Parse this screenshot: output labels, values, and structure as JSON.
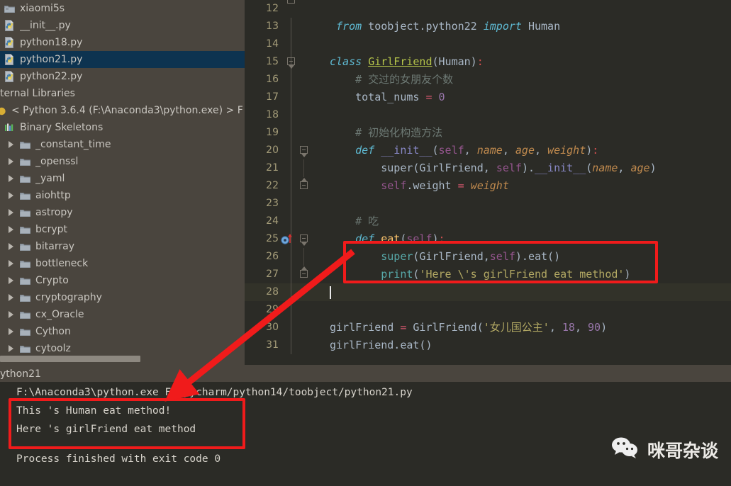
{
  "sidebar": {
    "top_partial_row": "",
    "items": [
      {
        "label": "xiaomi5s",
        "icon": "folder-icon",
        "type": "folder-plain",
        "selected": false
      },
      {
        "label": "__init__.py",
        "icon": "python-file-icon",
        "type": "pyfile",
        "selected": false
      },
      {
        "label": "python18.py",
        "icon": "python-file-icon",
        "type": "pyfile",
        "selected": false
      },
      {
        "label": "python21.py",
        "icon": "python-file-icon",
        "type": "pyfile",
        "selected": true
      },
      {
        "label": "python22.py",
        "icon": "python-file-icon",
        "type": "pyfile",
        "selected": false
      },
      {
        "label": "ternal Libraries",
        "icon": "none",
        "type": "text",
        "selected": false
      },
      {
        "label": "< Python 3.6.4 (F:\\Anaconda3\\python.exe) >  F",
        "icon": "sdk-icon",
        "type": "sdk",
        "selected": false
      },
      {
        "label": "Binary Skeletons",
        "icon": "skeleton-icon",
        "type": "skeleton",
        "selected": false
      },
      {
        "label": "_constant_time",
        "icon": "folder-icon",
        "type": "folder",
        "selected": false
      },
      {
        "label": "_openssl",
        "icon": "folder-icon",
        "type": "folder",
        "selected": false
      },
      {
        "label": "_yaml",
        "icon": "folder-icon",
        "type": "folder",
        "selected": false
      },
      {
        "label": "aiohttp",
        "icon": "folder-icon",
        "type": "folder",
        "selected": false
      },
      {
        "label": "astropy",
        "icon": "folder-icon",
        "type": "folder",
        "selected": false
      },
      {
        "label": "bcrypt",
        "icon": "folder-icon",
        "type": "folder",
        "selected": false
      },
      {
        "label": "bitarray",
        "icon": "folder-icon",
        "type": "folder",
        "selected": false
      },
      {
        "label": "bottleneck",
        "icon": "folder-icon",
        "type": "folder",
        "selected": false
      },
      {
        "label": "Crypto",
        "icon": "folder-icon",
        "type": "folder",
        "selected": false
      },
      {
        "label": "cryptography",
        "icon": "folder-icon",
        "type": "folder",
        "selected": false
      },
      {
        "label": "cx_Oracle",
        "icon": "folder-icon",
        "type": "folder",
        "selected": false
      },
      {
        "label": "Cython",
        "icon": "folder-icon",
        "type": "folder",
        "selected": false
      },
      {
        "label": "cytoolz",
        "icon": "folder-icon",
        "type": "folder",
        "selected": false
      }
    ]
  },
  "editor": {
    "lines": [
      {
        "n": "12",
        "tokens": [],
        "fold": "end-top",
        "current": false
      },
      {
        "n": "13",
        "tokens": [
          {
            "t": " ",
            "c": "plain"
          },
          {
            "t": "from",
            "c": "kw2"
          },
          {
            "t": " toobject.python22 ",
            "c": "plain"
          },
          {
            "t": "import",
            "c": "kw2"
          },
          {
            "t": " Human",
            "c": "plain"
          }
        ],
        "fold": "line",
        "current": false
      },
      {
        "n": "14",
        "tokens": [],
        "fold": "line",
        "current": false
      },
      {
        "n": "15",
        "tokens": [
          {
            "t": "class",
            "c": "kw2"
          },
          {
            "t": " ",
            "c": "plain"
          },
          {
            "t": "GirlFriend",
            "c": "cls"
          },
          {
            "t": "(Human)",
            "c": "plain"
          },
          {
            "t": ":",
            "c": "punct"
          }
        ],
        "fold": "open",
        "current": false
      },
      {
        "n": "16",
        "tokens": [
          {
            "t": "    # 交过的女朋友个数",
            "c": "cmt"
          }
        ],
        "fold": "bar",
        "current": false
      },
      {
        "n": "17",
        "tokens": [
          {
            "t": "    total_nums ",
            "c": "plain"
          },
          {
            "t": "=",
            "c": "op"
          },
          {
            "t": " ",
            "c": "plain"
          },
          {
            "t": "0",
            "c": "num"
          }
        ],
        "fold": "bar",
        "current": false
      },
      {
        "n": "18",
        "tokens": [],
        "fold": "bar",
        "current": false
      },
      {
        "n": "19",
        "tokens": [
          {
            "t": "    # 初始化构造方法",
            "c": "cmt"
          }
        ],
        "fold": "bar",
        "current": false
      },
      {
        "n": "20",
        "tokens": [
          {
            "t": "    ",
            "c": "plain"
          },
          {
            "t": "def",
            "c": "kw2"
          },
          {
            "t": " ",
            "c": "plain"
          },
          {
            "t": "__init__",
            "c": "builtin"
          },
          {
            "t": "(",
            "c": "plain"
          },
          {
            "t": "self",
            "c": "self"
          },
          {
            "t": ", ",
            "c": "plain"
          },
          {
            "t": "name",
            "c": "param"
          },
          {
            "t": ", ",
            "c": "plain"
          },
          {
            "t": "age",
            "c": "param"
          },
          {
            "t": ", ",
            "c": "plain"
          },
          {
            "t": "weight",
            "c": "param"
          },
          {
            "t": ")",
            "c": "plain"
          },
          {
            "t": ":",
            "c": "punct"
          }
        ],
        "fold": "open-inner",
        "current": false
      },
      {
        "n": "21",
        "tokens": [
          {
            "t": "        super(GirlFriend, ",
            "c": "plain"
          },
          {
            "t": "self",
            "c": "self"
          },
          {
            "t": ").",
            "c": "plain"
          },
          {
            "t": "__init__",
            "c": "builtin"
          },
          {
            "t": "(",
            "c": "plain"
          },
          {
            "t": "name",
            "c": "param"
          },
          {
            "t": ", ",
            "c": "plain"
          },
          {
            "t": "age",
            "c": "param"
          },
          {
            "t": ")",
            "c": "plain"
          }
        ],
        "fold": "bar2",
        "current": false
      },
      {
        "n": "22",
        "tokens": [
          {
            "t": "        ",
            "c": "plain"
          },
          {
            "t": "self",
            "c": "self"
          },
          {
            "t": ".weight ",
            "c": "plain"
          },
          {
            "t": "=",
            "c": "op"
          },
          {
            "t": " ",
            "c": "plain"
          },
          {
            "t": "weight",
            "c": "param"
          }
        ],
        "fold": "close-inner",
        "current": false
      },
      {
        "n": "23",
        "tokens": [],
        "fold": "bar",
        "current": false
      },
      {
        "n": "24",
        "tokens": [
          {
            "t": "    # 吃",
            "c": "cmt"
          }
        ],
        "fold": "bar",
        "current": false
      },
      {
        "n": "25",
        "tokens": [
          {
            "t": "    ",
            "c": "plain"
          },
          {
            "t": "def",
            "c": "kw2"
          },
          {
            "t": " ",
            "c": "plain"
          },
          {
            "t": "eat",
            "c": "fn"
          },
          {
            "t": "(",
            "c": "plain"
          },
          {
            "t": "self",
            "c": "self"
          },
          {
            "t": ")",
            "c": "plain"
          },
          {
            "t": ":",
            "c": "punct"
          }
        ],
        "fold": "open-inner",
        "current": false,
        "gutter_icon": "override-method-icon"
      },
      {
        "n": "26",
        "tokens": [
          {
            "t": "        ",
            "c": "plain"
          },
          {
            "t": "super",
            "c": "pyfn"
          },
          {
            "t": "(GirlFriend,",
            "c": "plain"
          },
          {
            "t": "self",
            "c": "self"
          },
          {
            "t": ").eat()",
            "c": "plain"
          }
        ],
        "fold": "bar2",
        "current": false
      },
      {
        "n": "27",
        "tokens": [
          {
            "t": "        ",
            "c": "plain"
          },
          {
            "t": "print",
            "c": "pyfn"
          },
          {
            "t": "(",
            "c": "plain"
          },
          {
            "t": "'Here \\'s girlFriend eat method'",
            "c": "str"
          },
          {
            "t": ")",
            "c": "plain"
          }
        ],
        "fold": "close-inner",
        "current": false
      },
      {
        "n": "28",
        "tokens": [],
        "fold": "bar",
        "current": true,
        "caret": true
      },
      {
        "n": "29",
        "tokens": [],
        "fold": "bar",
        "current": false
      },
      {
        "n": "30",
        "tokens": [
          {
            "t": "girlFriend ",
            "c": "plain"
          },
          {
            "t": "=",
            "c": "op"
          },
          {
            "t": " GirlFriend(",
            "c": "plain"
          },
          {
            "t": "'女儿国公主'",
            "c": "str"
          },
          {
            "t": ", ",
            "c": "plain"
          },
          {
            "t": "18",
            "c": "num"
          },
          {
            "t": ", ",
            "c": "plain"
          },
          {
            "t": "90",
            "c": "num"
          },
          {
            "t": ")",
            "c": "plain"
          }
        ],
        "fold": "bar",
        "current": false
      },
      {
        "n": "31",
        "tokens": [
          {
            "t": "girlFriend.eat()",
            "c": "plain"
          }
        ],
        "fold": "bar",
        "current": false
      }
    ]
  },
  "console": {
    "tab_label": "ython21",
    "lines": [
      "F:\\Anaconda3\\python.exe F:/pycharm/python14/toobject/python21.py",
      "This 's Human eat method!",
      "Here 's girlFriend eat method"
    ],
    "exit_line": "Process finished with exit code 0"
  },
  "watermark": {
    "text": "咪哥杂谈",
    "icon": "wechat-icon"
  },
  "annotations": {
    "highlight_color": "#f01b1b",
    "code_box_label": "code-highlight-box",
    "output_box_label": "output-highlight-box",
    "arrow_label": "red-pointer-arrow"
  }
}
